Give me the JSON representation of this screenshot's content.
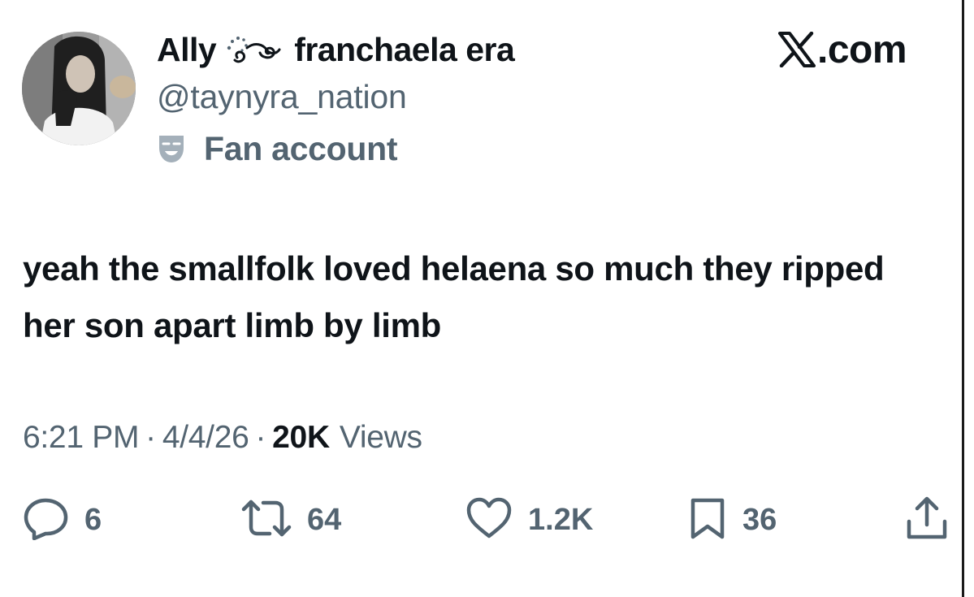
{
  "author": {
    "display_name_start": "Ally",
    "display_name_end": "franchaela era",
    "handle": "@taynyra_nation",
    "label": "Fan account",
    "emoji_icon": "swirl-icon"
  },
  "source": {
    "site": ".com",
    "logo_icon": "x-logo-icon"
  },
  "tweet": {
    "text": "yeah the smallfolk loved helaena so much they ripped her son apart limb by limb",
    "time": "6:21 PM",
    "date": "4/4/26",
    "views_count": "20K",
    "views_label": "Views",
    "separator": "·"
  },
  "actions": {
    "replies": "6",
    "reposts": "64",
    "likes": "1.2K",
    "bookmarks": "36"
  },
  "colors": {
    "text_primary": "#0f1419",
    "text_secondary": "#536471",
    "background": "#ffffff"
  }
}
